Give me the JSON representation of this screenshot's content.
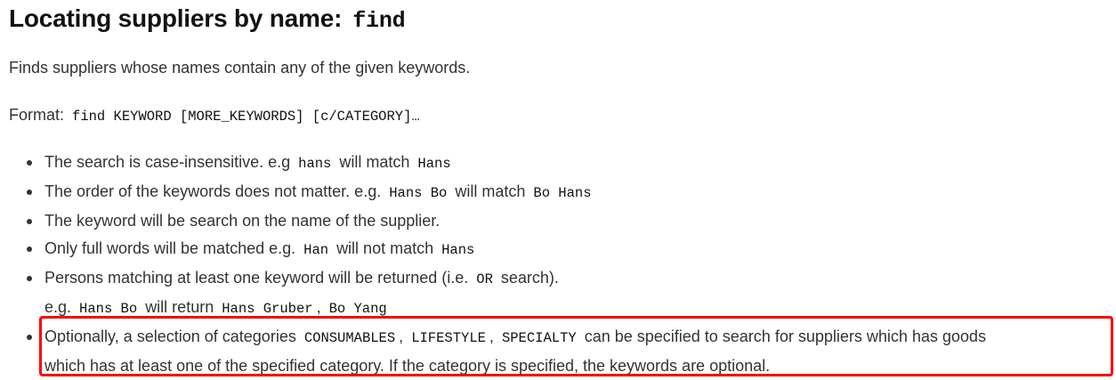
{
  "heading": {
    "text": "Locating suppliers by name:",
    "command": "find"
  },
  "description": "Finds suppliers whose names contain any of the given keywords.",
  "format": {
    "label": "Format:",
    "code": "find KEYWORD [MORE_KEYWORDS] [c/CATEGORY]…"
  },
  "bullets": [
    {
      "t1": "The search is case-insensitive. e.g",
      "c1": "hans",
      "t2": "will match",
      "c2": "Hans"
    },
    {
      "t1": "The order of the keywords does not matter. e.g.",
      "c1": "Hans Bo",
      "t2": "will match",
      "c2": "Bo Hans"
    },
    {
      "t1": "The keyword will be search on the name of the supplier."
    },
    {
      "t1": "Only full words will be matched e.g.",
      "c1": "Han",
      "t2": "will not match",
      "c2": "Hans"
    },
    {
      "t1": "Persons matching at least one keyword will be returned (i.e.",
      "c1": "OR",
      "t2": "search).",
      "line2": {
        "t1": "e.g.",
        "c1": "Hans Bo",
        "t2": "will return",
        "c2": "Hans Gruber",
        "sep": ",",
        "c3": "Bo Yang"
      }
    },
    {
      "t1": "Optionally, a selection of categories",
      "c1": "CONSUMABLES",
      "sep1": ",",
      "c2": "LIFESTYLE",
      "sep2": ",",
      "c3": "SPECIALTY",
      "t2": "can be specified to search for suppliers which has goods",
      "line2": "which has at least one of the specified category. If the category is specified, the keywords are optional."
    }
  ],
  "colors": {
    "highlight_border": "#ff0000",
    "text": "#333333"
  }
}
